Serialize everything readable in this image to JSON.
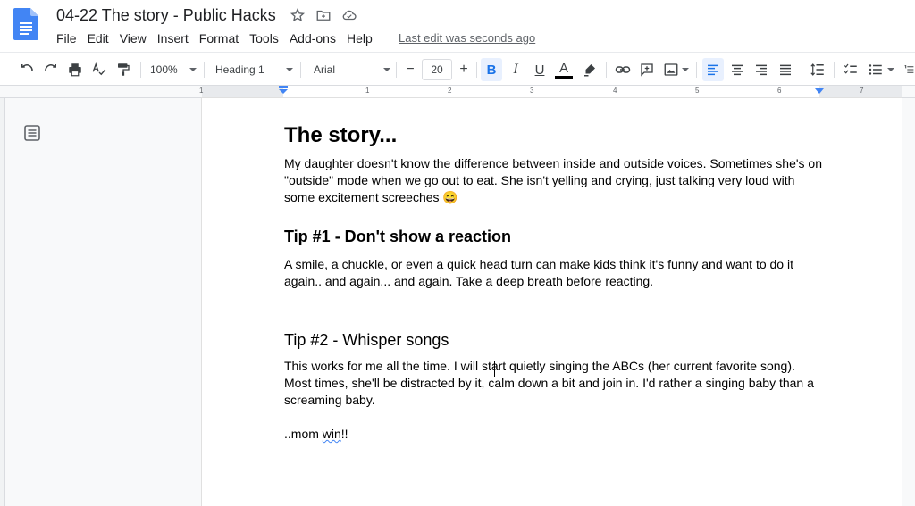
{
  "app": {
    "doc_title": "04-22 The story - Public Hacks",
    "last_edit": "Last edit was seconds ago"
  },
  "menu": [
    "File",
    "Edit",
    "View",
    "Insert",
    "Format",
    "Tools",
    "Add-ons",
    "Help"
  ],
  "toolbar": {
    "zoom": "100%",
    "style": "Heading 1",
    "font": "Arial",
    "font_size": "20",
    "minus": "−",
    "plus": "+",
    "bold": "B",
    "italic": "I",
    "underline": "U",
    "text_color": "A"
  },
  "ruler": {
    "numbers": [
      "1",
      "1",
      "2",
      "3",
      "4",
      "5",
      "6",
      "7"
    ]
  },
  "doc": {
    "title": "The story...",
    "intro": "My daughter doesn't know the difference between inside and outside voices. Sometimes she's on \"outside\" mode when we go out to eat. She isn't yelling and crying, just talking very loud with some excitement screeches 😄",
    "tip1_heading": "Tip #1 - Don't show a reaction",
    "tip1_body": "A smile, a chuckle, or even a quick head turn can make kids think it's funny and want to do it again.. and again... and again. Take a deep breath before reacting.",
    "tip2_heading": "Tip #2 - Whisper songs",
    "tip2_body": "This works for me all the time. I will start quietly singing the ABCs (her current favorite song). Most times, she'll be distracted by it, calm down a bit and join in. I'd rather a singing baby than a screaming baby.",
    "signoff_prefix": "..mom ",
    "signoff_word": "win",
    "signoff_suffix": "!!"
  },
  "colors": {
    "accent": "#1a73e8",
    "docs_blue": "#4285f4"
  }
}
